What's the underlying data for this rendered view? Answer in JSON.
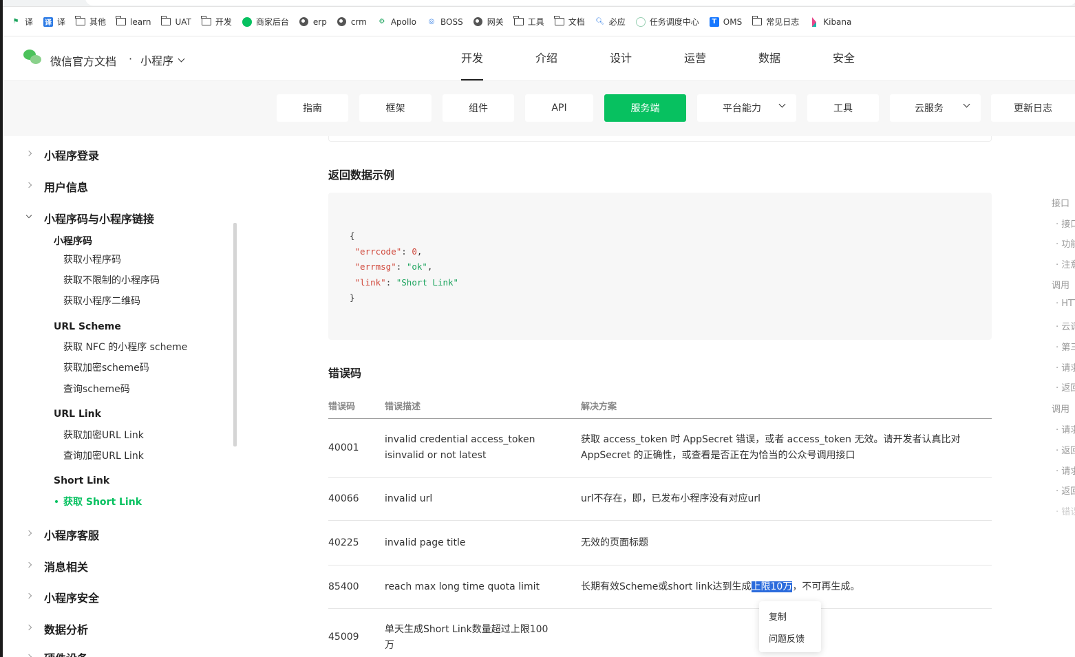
{
  "bookmarks": [
    {
      "icon": "flag-icon",
      "label": "译"
    },
    {
      "icon": "translate-icon",
      "label": "译"
    },
    {
      "icon": "folder-icon",
      "label": "其他"
    },
    {
      "icon": "folder-icon",
      "label": "learn"
    },
    {
      "icon": "folder-icon",
      "label": "UAT"
    },
    {
      "icon": "folder-icon",
      "label": "开发"
    },
    {
      "icon": "shop-icon",
      "label": "商家后台"
    },
    {
      "icon": "globe-icon",
      "label": "erp"
    },
    {
      "icon": "globe-icon",
      "label": "crm"
    },
    {
      "icon": "gear-icon",
      "label": "Apollo"
    },
    {
      "icon": "boss-icon",
      "label": "BOSS"
    },
    {
      "icon": "globe-icon",
      "label": "网关"
    },
    {
      "icon": "folder-icon",
      "label": "工具"
    },
    {
      "icon": "folder-icon",
      "label": "文档"
    },
    {
      "icon": "search-icon",
      "label": "必应"
    },
    {
      "icon": "scheduler-icon",
      "label": "任务调度中心"
    },
    {
      "icon": "oms-icon",
      "label": "OMS"
    },
    {
      "icon": "folder-icon",
      "label": "常见日志"
    },
    {
      "icon": "kibana-icon",
      "label": "Kibana"
    }
  ],
  "header": {
    "brand": "微信官方文档",
    "dot": "·",
    "product": "小程序",
    "nav": [
      "开发",
      "介绍",
      "设计",
      "运营",
      "数据",
      "安全"
    ],
    "active_nav": "开发"
  },
  "subnav": {
    "tabs": [
      "指南",
      "框架",
      "组件",
      "API",
      "服务端",
      "平台能力",
      "工具",
      "云服务",
      "更新日志"
    ],
    "active": "服务端",
    "accent": "#07c160"
  },
  "sidebar": {
    "sections_top": [
      "小程序登录",
      "用户信息"
    ],
    "open_section": "小程序码与小程序链接",
    "groups": [
      {
        "title": "小程序码",
        "items": [
          "获取小程序码",
          "获取不限制的小程序码",
          "获取小程序二维码"
        ]
      },
      {
        "title": "URL Scheme",
        "items": [
          "获取 NFC 的小程序 scheme",
          "获取加密scheme码",
          "查询scheme码"
        ]
      },
      {
        "title": "URL Link",
        "items": [
          "获取加密URL Link",
          "查询加密URL Link"
        ]
      },
      {
        "title": "Short Link",
        "items": [
          "获取 Short Link"
        ]
      }
    ],
    "active_item": "获取 Short Link",
    "sections_bottom": [
      "小程序客服",
      "消息相关",
      "小程序安全",
      "数据分析",
      "硬件设备"
    ]
  },
  "content": {
    "return_title": "返回数据示例",
    "code": {
      "open": "{",
      "lines": [
        {
          "key": "\"errcode\"",
          "value": "0",
          "type": "num",
          "sep": ","
        },
        {
          "key": "\"errmsg\"",
          "value": "\"ok\"",
          "type": "str",
          "sep": ","
        },
        {
          "key": "\"link\"",
          "value": "\"Short Link\"",
          "type": "str",
          "sep": ""
        }
      ],
      "close": "}"
    },
    "error_title": "错误码",
    "table": {
      "headers": [
        "错误码",
        "错误描述",
        "解决方案"
      ],
      "rows": [
        {
          "code": "40001",
          "desc": "invalid credential  access_token isinvalid or not latest",
          "solution": "获取 access_token 时 AppSecret 错误，或者 access_token 无效。请开发者认真比对 AppSecret 的正确性，或查看是否正在为恰当的公众号调用接口"
        },
        {
          "code": "40066",
          "desc": "invalid url",
          "solution": "url不存在，即，已发布小程序没有对应url"
        },
        {
          "code": "40225",
          "desc": "invalid page title",
          "solution": "无效的页面标题"
        },
        {
          "code": "85400",
          "desc": "reach max long time quota limit",
          "solution_pre": "长期有效Scheme或short link达到生成",
          "solution_hl": "上限10万",
          "solution_post": "，不可再生成。"
        },
        {
          "code": "45009",
          "desc": "单天生成Short Link数量超过上限100万",
          "solution": ""
        }
      ]
    }
  },
  "toc": [
    "接口",
    "· 接口",
    "· 功能",
    "· 注意",
    "调用",
    "· HTT",
    "· 云调",
    "· 第三",
    "· 请求",
    "· 返回",
    "调用",
    "· 请求",
    "· 返回",
    "· 请求",
    "· 返回",
    "· 错误"
  ],
  "context_menu": [
    "复制",
    "问题反馈"
  ]
}
